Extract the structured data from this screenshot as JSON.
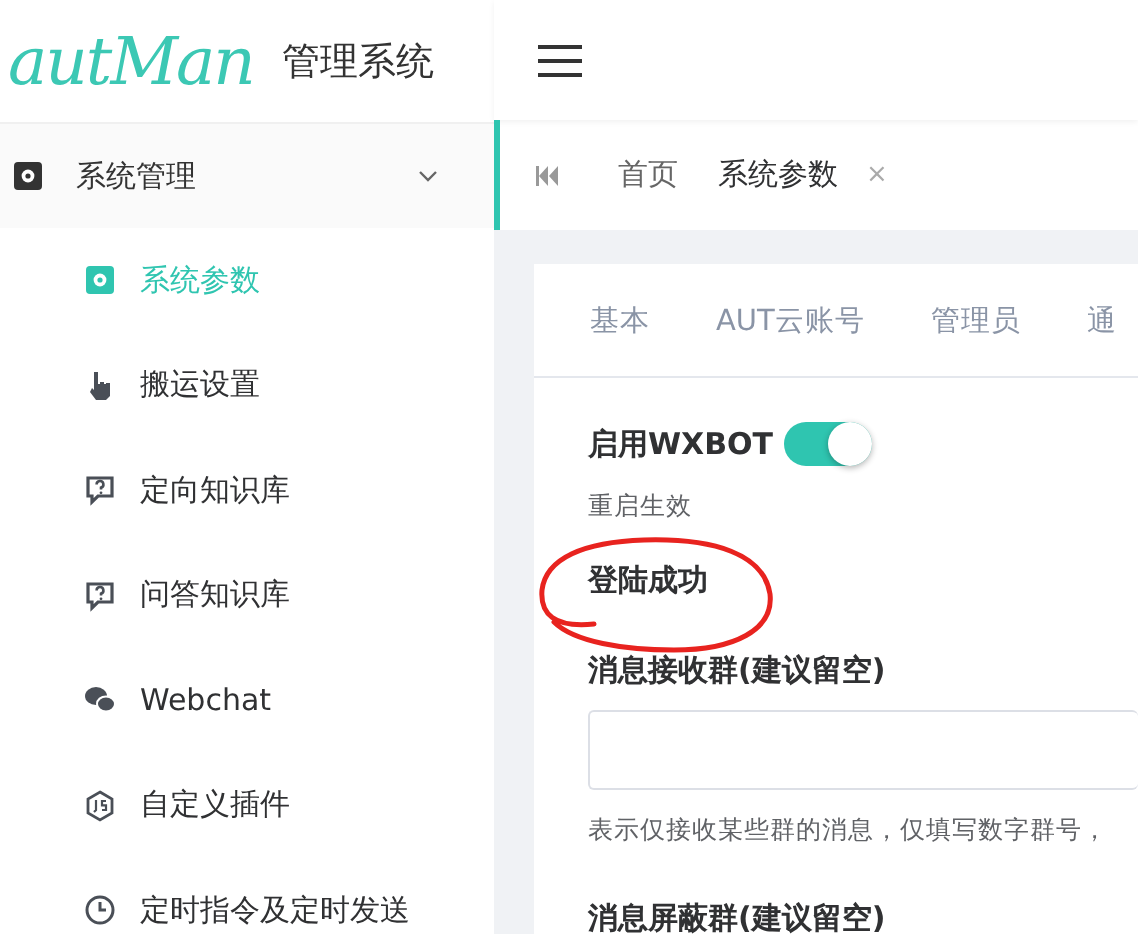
{
  "logo": {
    "script": "autMan",
    "title": "管理系统"
  },
  "sidebar": {
    "group": {
      "label": "系统管理",
      "expanded": true
    },
    "items": [
      {
        "label": "系统参数",
        "selected": true
      },
      {
        "label": "搬运设置",
        "selected": false
      },
      {
        "label": "定向知识库",
        "selected": false
      },
      {
        "label": "问答知识库",
        "selected": false
      },
      {
        "label": "Webchat",
        "selected": false
      },
      {
        "label": "自定义插件",
        "selected": false
      },
      {
        "label": "定时指令及定时发送",
        "selected": false
      }
    ]
  },
  "page_tabs": [
    {
      "label": "首页",
      "selected": false
    },
    {
      "label": "系统参数",
      "selected": true,
      "close": "×"
    }
  ],
  "settings_tabs": [
    {
      "label": "基本"
    },
    {
      "label": "AUT云账号"
    },
    {
      "label": "管理员"
    },
    {
      "label": "通"
    }
  ],
  "form": {
    "switch": {
      "label": "启用WXBOT",
      "on": true,
      "note": "重启生效"
    },
    "status": "登陆成功",
    "fields": [
      {
        "label": "消息接收群(建议留空)",
        "hint": "表示仅接收某些群的消息，仅填写数字群号，"
      },
      {
        "label": "消息屏蔽群(建议留空)"
      }
    ]
  }
}
